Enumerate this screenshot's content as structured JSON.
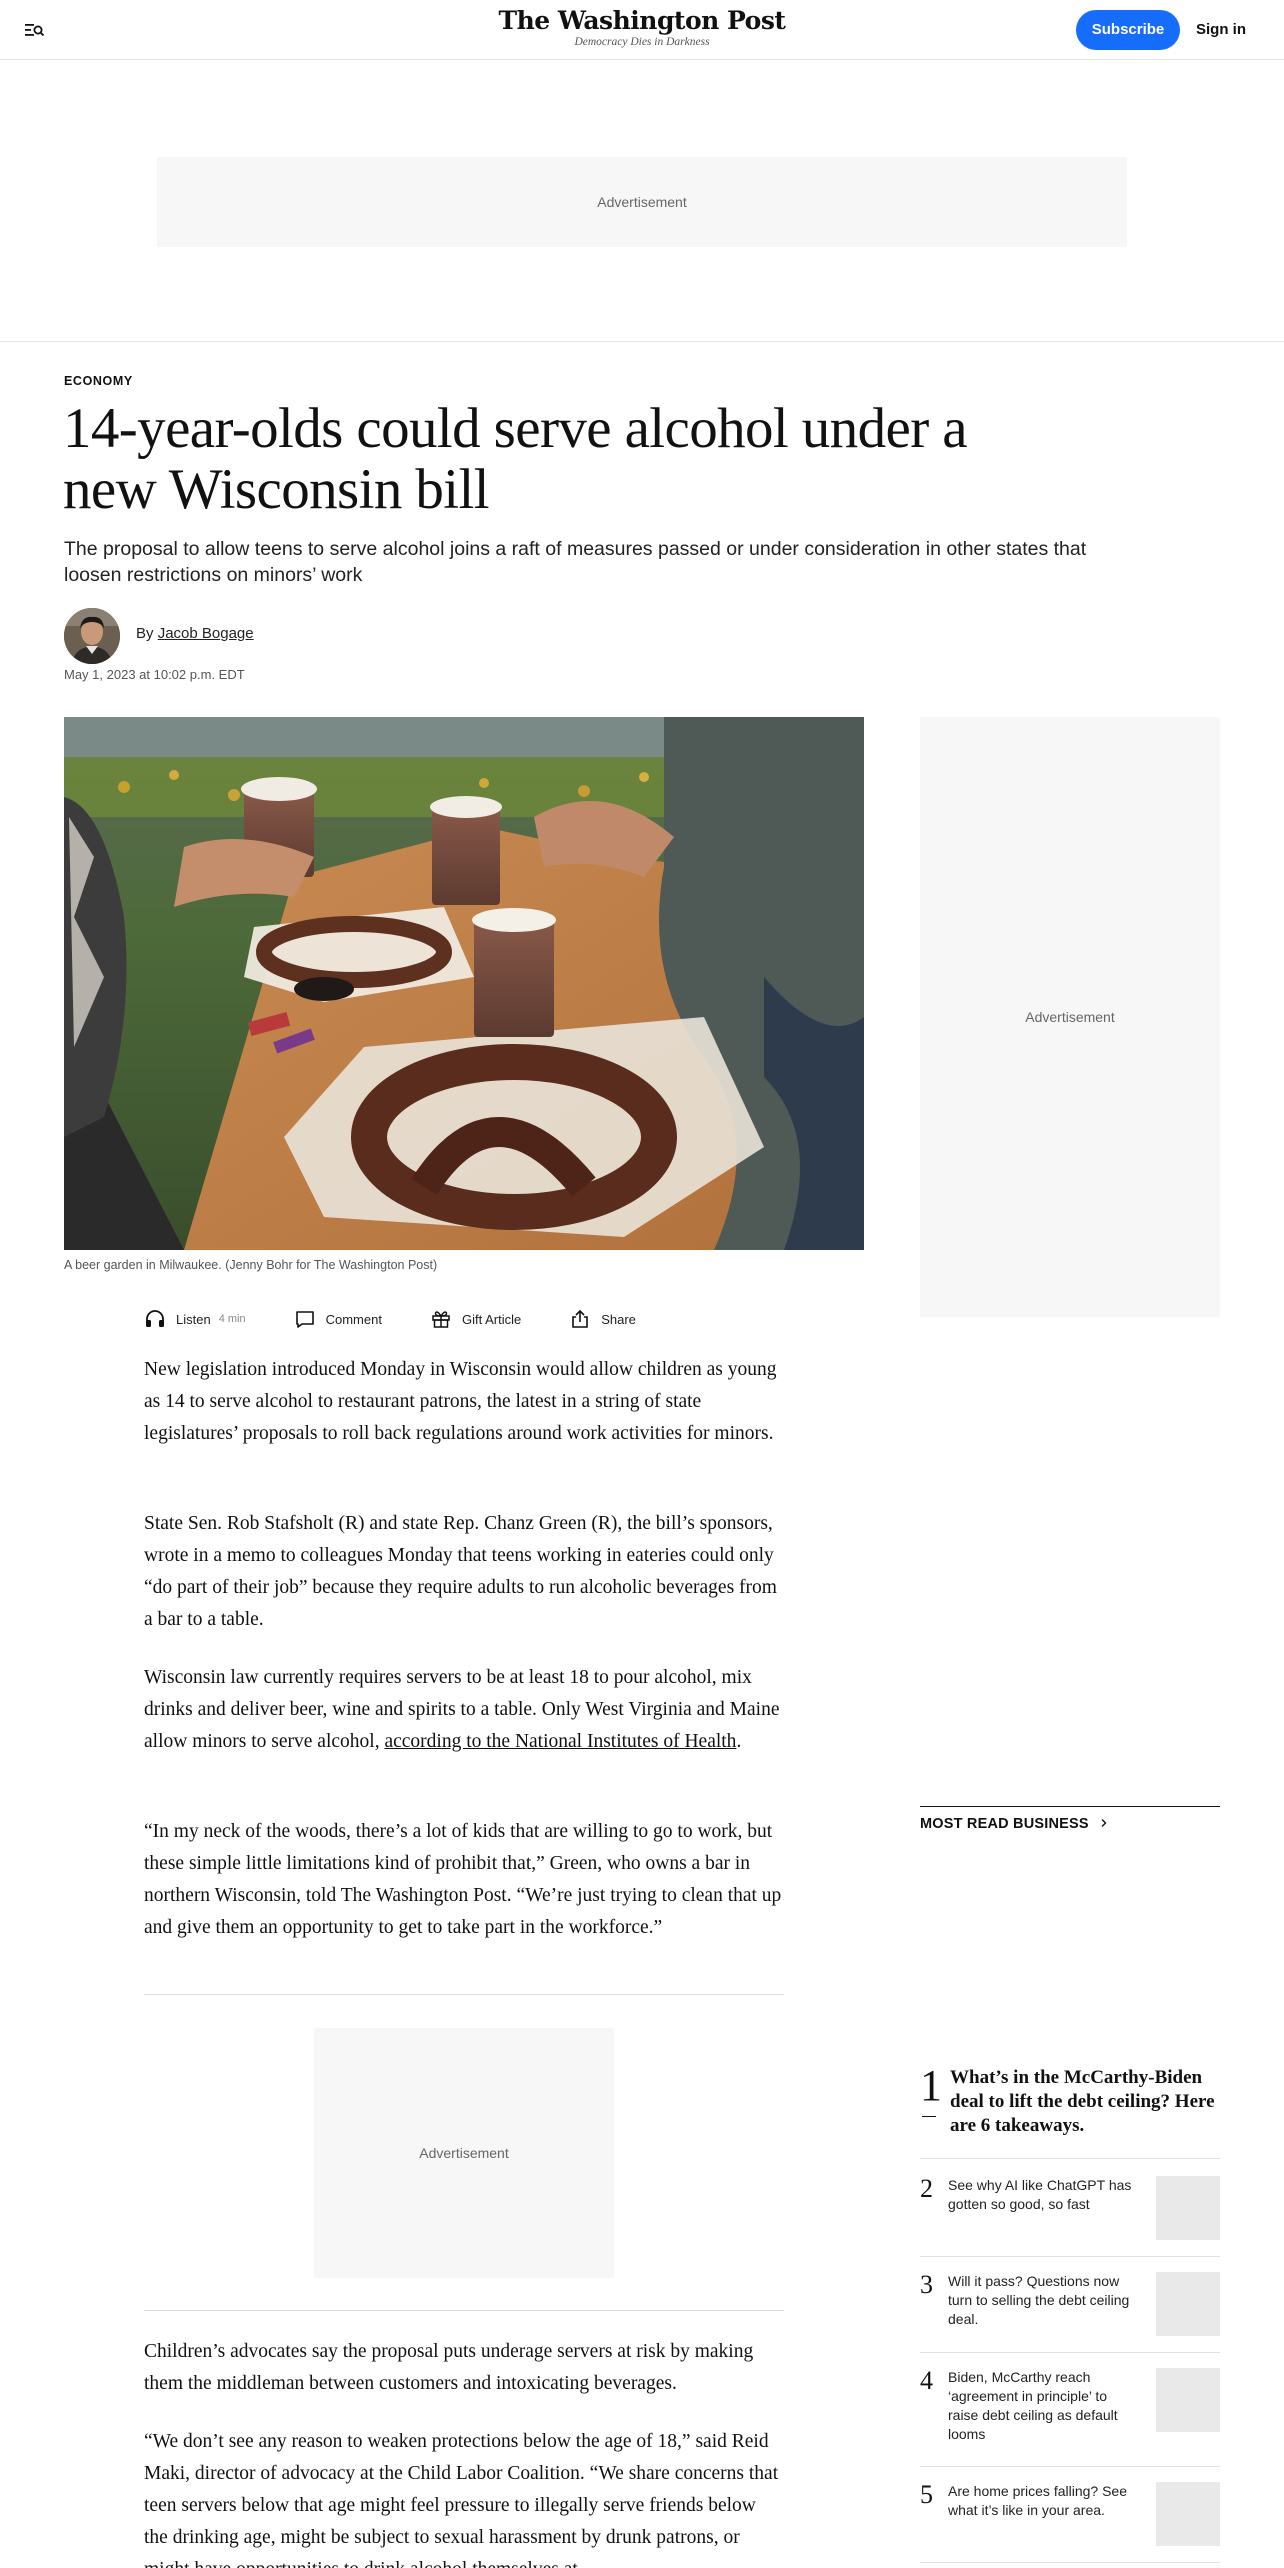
{
  "header": {
    "logo_name": "The Washington Post",
    "logo_tagline": "Democracy Dies in Darkness",
    "subscribe_label": "Subscribe",
    "signin_label": "Sign in",
    "menu_icon": "menu-search-icon"
  },
  "ads": {
    "top_label": "Advertisement",
    "rail_label": "Advertisement",
    "inline_label": "Advertisement"
  },
  "article": {
    "kicker": "ECONOMY",
    "headline": "14-year-olds could serve alcohol under a new Wisconsin bill",
    "dek": "The proposal to allow teens to serve alcohol joins a raft of measures passed or under consideration in other states that loosen restrictions on minors’ work",
    "byline_prefix": "By",
    "author": "Jacob Bogage",
    "dateline": "May 1, 2023 at 10:02 p.m. EDT",
    "image_caption": "A beer garden in Milwaukee. (Jenny Bohr for The Washington Post)",
    "paragraphs": {
      "p1": "New legislation introduced Monday in Wisconsin would allow children as young as 14 to serve alcohol to restaurant patrons, the latest in a string of state legislatures’ proposals to roll back regulations around work activities for minors.",
      "p2": "State Sen. Rob Stafsholt (R) and state Rep. Chanz Green (R), the bill’s sponsors, wrote in a memo to colleagues Monday that teens working in eateries could only “do part of their job” because they require adults to run alcoholic beverages from a bar to a table.",
      "p3_before": "Wisconsin law currently requires servers to be at least 18 to pour alcohol, mix drinks and deliver beer, wine and spirits to a table. Only West Virginia and Maine allow minors to serve alcohol, ",
      "p3_link": "according to the National Institutes of Health",
      "p3_after": ".",
      "p4": "“In my neck of the woods, there’s a lot of kids that are willing to go to work, but these simple little limitations kind of prohibit that,” Green, who owns a bar in northern Wisconsin, told The Washington Post. “We’re just trying to clean that up and give them an opportunity to get to take part in the workforce.”",
      "p5": "Children’s advocates say the proposal puts underage servers at risk by making them the middleman between customers and intoxicating beverages.",
      "p6": "“We don’t see any reason to weaken protections below the age of 18,” said Reid Maki, director of advocacy at the Child Labor Coalition. “We share concerns that teen servers below that age might feel pressure to illegally serve friends below the drinking age, might be subject to sexual harassment by drunk patrons, or might have opportunities to drink alcohol themselves at"
    }
  },
  "actions": {
    "listen_label": "Listen",
    "listen_duration": "4 min",
    "comment_label": "Comment",
    "gift_label": "Gift Article",
    "share_label": "Share"
  },
  "most_read": {
    "title": "MOST READ BUSINESS",
    "items": [
      {
        "num": "1",
        "title": "What’s in the McCarthy-Biden deal to lift the debt ceiling? Here are 6 takeaways."
      },
      {
        "num": "2",
        "title": "See why AI like ChatGPT has gotten so good, so fast"
      },
      {
        "num": "3",
        "title": "Will it pass? Questions now turn to selling the debt ceiling deal."
      },
      {
        "num": "4",
        "title": "Biden, McCarthy reach ‘agreement in principle’ to raise debt ceiling as default looms"
      },
      {
        "num": "5",
        "title": "Are home prices falling? See what it’s like in your area."
      }
    ]
  },
  "colors": {
    "subscribe_blue": "#166dfc",
    "ad_background": "#f7f7f7",
    "thumb_placeholder": "#e9e9e9"
  }
}
